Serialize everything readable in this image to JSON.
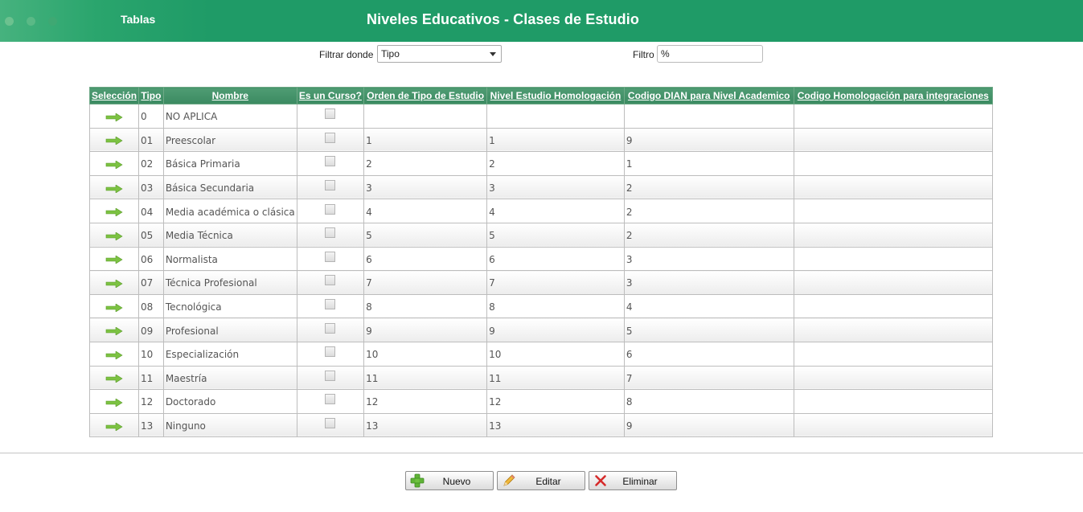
{
  "header": {
    "section": "Tablas",
    "title": "Niveles Educativos - Clases de Estudio"
  },
  "filter": {
    "where_label": "Filtrar donde",
    "where_value": "Tipo",
    "filter_label": "Filtro",
    "filter_value": "%"
  },
  "table": {
    "columns": [
      "Selección",
      "Tipo",
      "Nombre",
      "Es un Curso?",
      "Orden de Tipo de Estudio",
      "Nivel Estudio Homologación",
      "Codigo DIAN para Nivel Academico",
      "Codigo Homologación para integraciones"
    ],
    "rows": [
      {
        "tipo": "0",
        "nombre": "NO APLICA",
        "curso": false,
        "orden": "",
        "nivel": "",
        "dian": "",
        "homolog": ""
      },
      {
        "tipo": "01",
        "nombre": "Preescolar",
        "curso": false,
        "orden": "1",
        "nivel": "1",
        "dian": "9",
        "homolog": ""
      },
      {
        "tipo": "02",
        "nombre": "Básica Primaria",
        "curso": false,
        "orden": "2",
        "nivel": "2",
        "dian": "1",
        "homolog": ""
      },
      {
        "tipo": "03",
        "nombre": "Básica Secundaria",
        "curso": false,
        "orden": "3",
        "nivel": "3",
        "dian": "2",
        "homolog": ""
      },
      {
        "tipo": "04",
        "nombre": "Media académica o clásica",
        "curso": false,
        "orden": "4",
        "nivel": "4",
        "dian": "2",
        "homolog": ""
      },
      {
        "tipo": "05",
        "nombre": "Media Técnica",
        "curso": false,
        "orden": "5",
        "nivel": "5",
        "dian": "2",
        "homolog": ""
      },
      {
        "tipo": "06",
        "nombre": "Normalista",
        "curso": false,
        "orden": "6",
        "nivel": "6",
        "dian": "3",
        "homolog": ""
      },
      {
        "tipo": "07",
        "nombre": "Técnica Profesional",
        "curso": false,
        "orden": "7",
        "nivel": "7",
        "dian": "3",
        "homolog": ""
      },
      {
        "tipo": "08",
        "nombre": "Tecnológica",
        "curso": false,
        "orden": "8",
        "nivel": "8",
        "dian": "4",
        "homolog": ""
      },
      {
        "tipo": "09",
        "nombre": "Profesional",
        "curso": false,
        "orden": "9",
        "nivel": "9",
        "dian": "5",
        "homolog": ""
      },
      {
        "tipo": "10",
        "nombre": "Especialización",
        "curso": false,
        "orden": "10",
        "nivel": "10",
        "dian": "6",
        "homolog": ""
      },
      {
        "tipo": "11",
        "nombre": "Maestría",
        "curso": false,
        "orden": "11",
        "nivel": "11",
        "dian": "7",
        "homolog": ""
      },
      {
        "tipo": "12",
        "nombre": "Doctorado",
        "curso": false,
        "orden": "12",
        "nivel": "12",
        "dian": "8",
        "homolog": ""
      },
      {
        "tipo": "13",
        "nombre": "Ninguno",
        "curso": false,
        "orden": "13",
        "nivel": "13",
        "dian": "9",
        "homolog": ""
      }
    ]
  },
  "buttons": {
    "new_label": "Nuevo",
    "edit_label": "Editar",
    "delete_label": "Eliminar"
  },
  "icons": {
    "row_select": "arrow-right-icon",
    "new": "plus-icon",
    "edit": "pencil-icon",
    "delete": "x-icon"
  },
  "colors": {
    "header_green": "#1f9b67",
    "table_header_green": "#3b8a61",
    "arrow_green": "#7cc242"
  }
}
